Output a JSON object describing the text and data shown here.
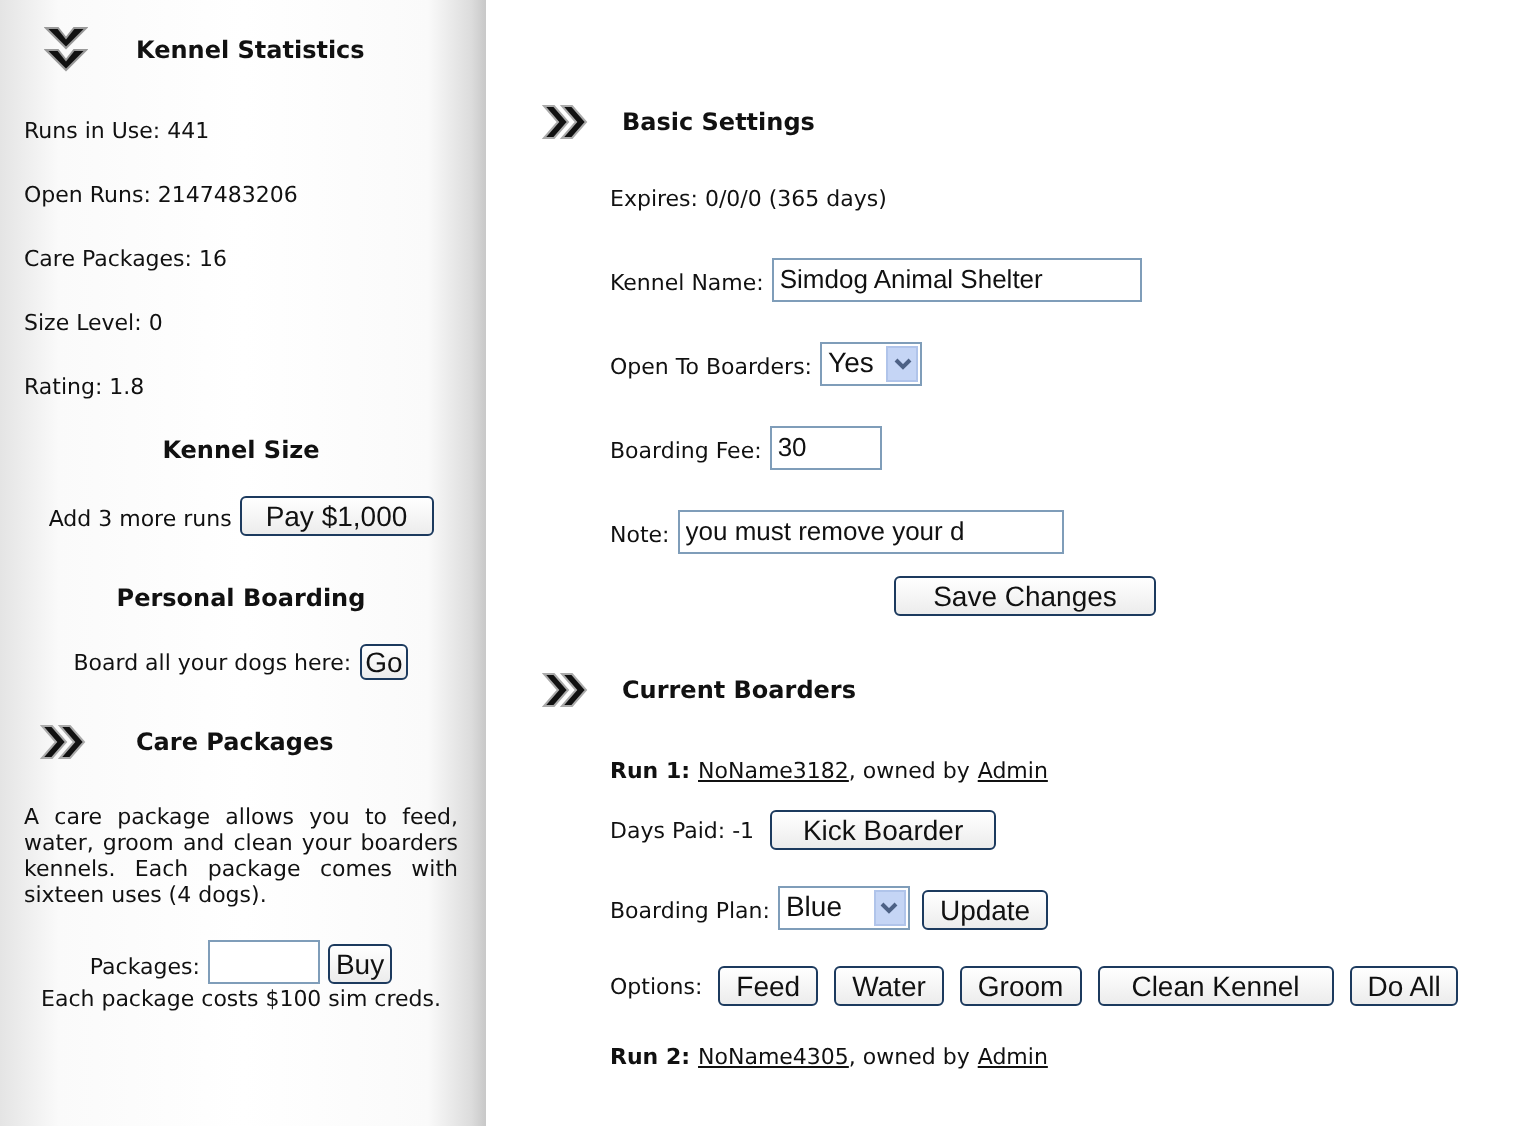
{
  "sidebar": {
    "stats_title": "Kennel Statistics",
    "stats": [
      "Runs in Use: 441",
      "Open Runs: 2147483206",
      "Care Packages: 16",
      "Size Level: 0",
      "Rating: 1.8"
    ],
    "kennel_size": {
      "heading": "Kennel Size",
      "text": "Add 3 more runs",
      "button": "Pay $1,000"
    },
    "personal_boarding": {
      "heading": "Personal Boarding",
      "text": "Board all your dogs here:",
      "button": "Go"
    },
    "care_packages": {
      "title": "Care Packages",
      "description": "A care package allows you to feed, water, groom and clean your boarders kennels. Each package comes with sixteen uses (4 dogs).",
      "field_label": "Packages:",
      "button": "Buy",
      "note": "Each package costs $100 sim creds."
    }
  },
  "basic_settings": {
    "title": "Basic Settings",
    "expires": "Expires: 0/0/0 (365 days)",
    "fields": [
      {
        "kind": "text",
        "label": "Kennel Name:",
        "value": "Simdog Animal Shelter"
      },
      {
        "kind": "select",
        "label": "Open To Boarders:",
        "value": "Yes"
      },
      {
        "kind": "short",
        "label": "Boarding Fee:",
        "value": "30"
      },
      {
        "kind": "text",
        "label": "Note:",
        "value": "you must remove your d"
      }
    ],
    "button": "Save Changes"
  },
  "current_boarders": {
    "title": "Current Boarders",
    "runs": [
      {
        "label": "Run 1:",
        "dog": "NoName3182",
        "owned_by": ", owned by",
        "owner": "Admin",
        "days_paid": "Days Paid: -1",
        "kick_button": "Kick Boarder",
        "plan_label": "Boarding Plan:",
        "plan_value": "Blue",
        "update_button": "Update",
        "options_label": "Options:",
        "options": [
          "Feed",
          "Water",
          "Groom",
          "Clean Kennel",
          "Do All"
        ]
      },
      {
        "label": "Run 2:",
        "dog": "NoName4305",
        "owned_by": ", owned by",
        "owner": "Admin"
      }
    ]
  }
}
